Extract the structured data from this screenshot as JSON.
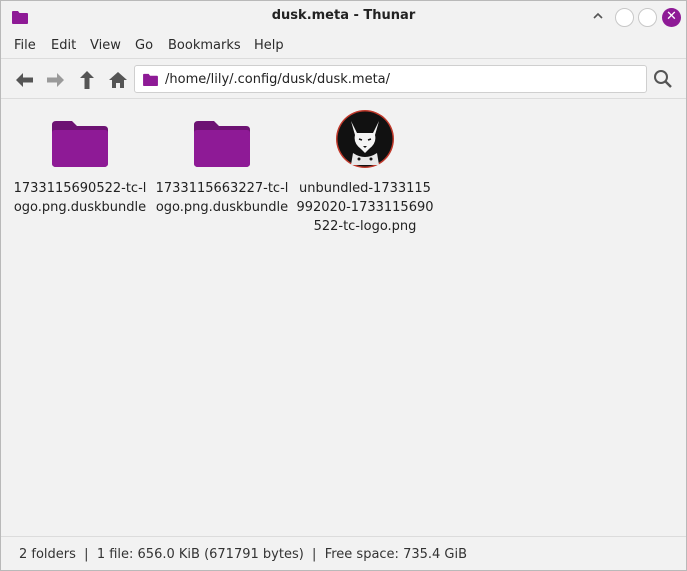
{
  "window": {
    "title": "dusk.meta - Thunar",
    "close_glyph": "✕"
  },
  "colors": {
    "folder": "#8e1a96",
    "folder_dark": "#6d1373",
    "close": "#8e1a96"
  },
  "menubar": {
    "items": [
      "File",
      "Edit",
      "View",
      "Go",
      "Bookmarks",
      "Help"
    ]
  },
  "toolbar": {
    "back_icon": "arrow-left-icon",
    "forward_icon": "arrow-right-icon",
    "up_icon": "arrow-up-icon",
    "home_icon": "home-icon",
    "location": "/home/lily/.config/dusk/dusk.meta/",
    "search_icon": "search-icon"
  },
  "files": [
    {
      "name": "1733115690522-tc-logo.png.duskbundle",
      "type": "folder"
    },
    {
      "name": "1733115663227-tc-logo.png.duskbundle",
      "type": "folder"
    },
    {
      "name": "unbundled-1733115992020-1733115690522-tc-logo.png",
      "type": "image"
    }
  ],
  "status": {
    "text": "2 folders  |  1 file: 656.0 KiB (671791 bytes)  |  Free space: 735.4 GiB"
  }
}
